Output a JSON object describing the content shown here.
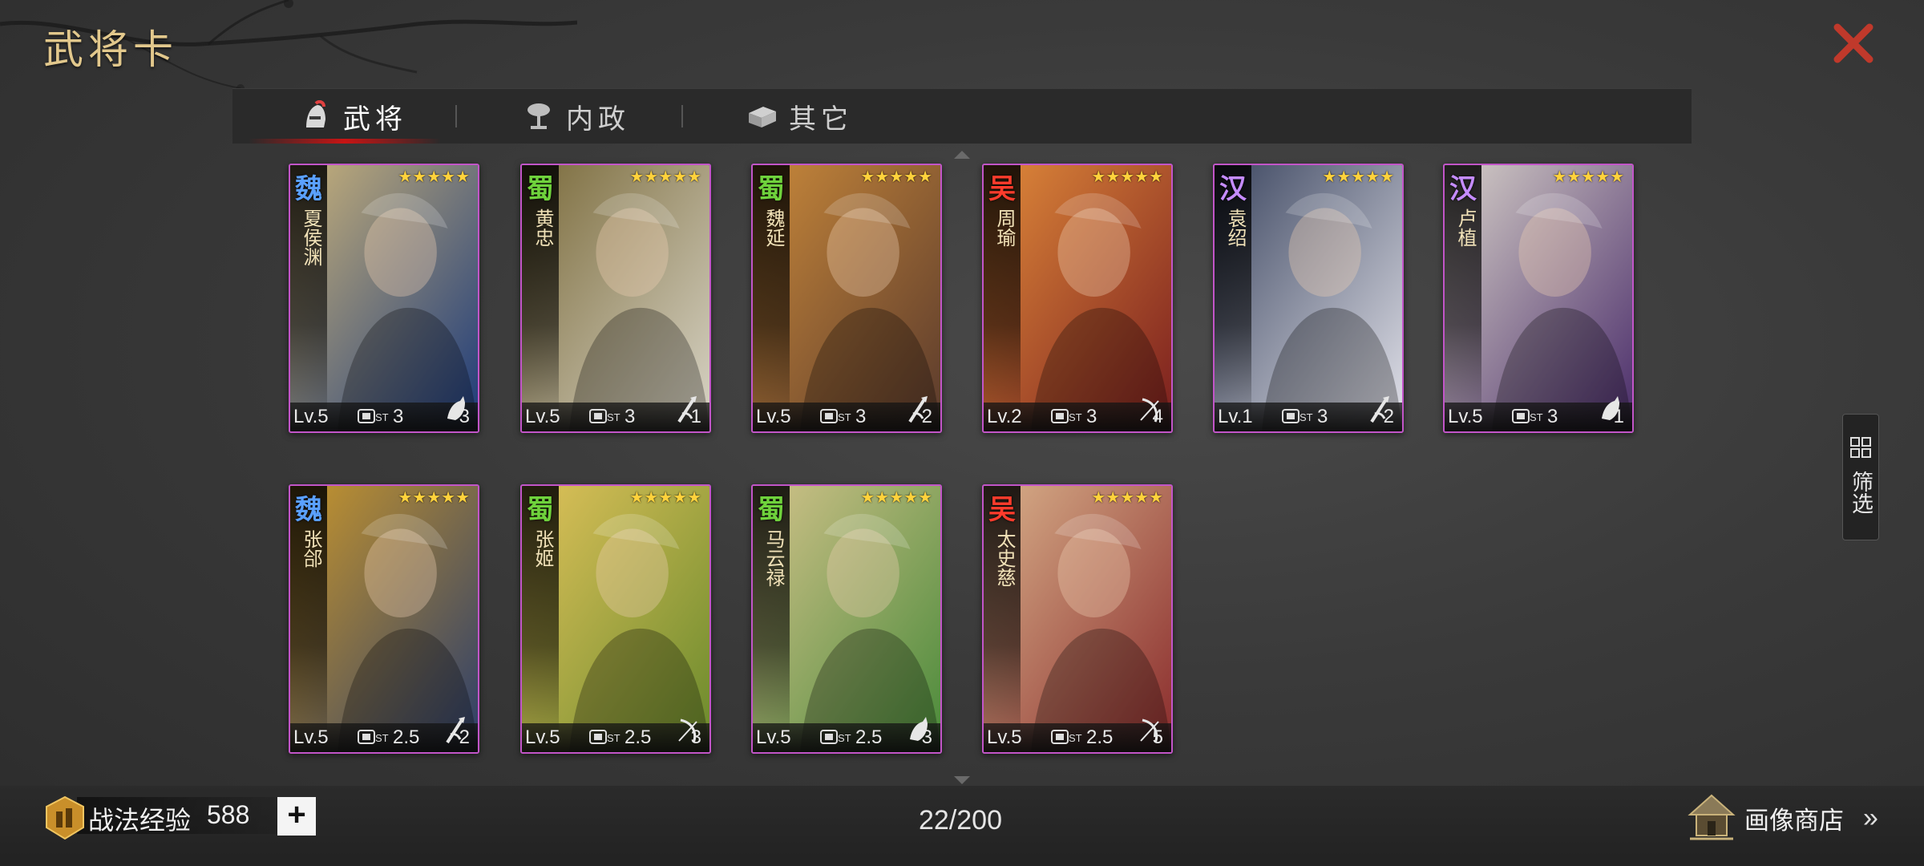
{
  "header": {
    "title": "武将卡"
  },
  "tabs": [
    {
      "label": "武将",
      "icon": "helmet-icon",
      "active": true
    },
    {
      "label": "内政",
      "icon": "tree-icon",
      "active": false
    },
    {
      "label": "其它",
      "icon": "box-icon",
      "active": false
    }
  ],
  "cards": [
    {
      "faction": "魏",
      "faction_color": "#5aa0ff",
      "name": "夏侯渊",
      "stars": "★★★★★",
      "level": "Lv.5",
      "cost": "3",
      "type_icon": "cavalry-icon",
      "count": "3",
      "palette": [
        "#1c3a7a",
        "#c9b27a"
      ]
    },
    {
      "faction": "蜀",
      "faction_color": "#6fd23c",
      "name": "黄忠",
      "stars": "★★★★★",
      "level": "Lv.5",
      "cost": "3",
      "type_icon": "spear-icon",
      "count": "1",
      "palette": [
        "#d8d4c6",
        "#7a6a3a"
      ]
    },
    {
      "faction": "蜀",
      "faction_color": "#6fd23c",
      "name": "魏延",
      "stars": "★★★★★",
      "level": "Lv.5",
      "cost": "3",
      "type_icon": "spear-icon",
      "count": "2",
      "palette": [
        "#5a3a2c",
        "#c8883a"
      ]
    },
    {
      "faction": "吴",
      "faction_color": "#ff3c2c",
      "name": "周瑜",
      "stars": "★★★★★",
      "level": "Lv.2",
      "cost": "3",
      "type_icon": "bow-icon",
      "count": "4",
      "palette": [
        "#7a1e1e",
        "#e08a3a"
      ]
    },
    {
      "faction": "汉",
      "faction_color": "#c58cff",
      "name": "袁绍",
      "stars": "★★★★★",
      "level": "Lv.1",
      "cost": "3",
      "type_icon": "spear-icon",
      "count": "2",
      "palette": [
        "#e2e2ea",
        "#3c4660"
      ]
    },
    {
      "faction": "汉",
      "faction_color": "#c58cff",
      "name": "卢植",
      "stars": "★★★★★",
      "level": "Lv.5",
      "cost": "3",
      "type_icon": "cavalry-icon",
      "count": "1",
      "palette": [
        "#4a2c6a",
        "#d6d0c8"
      ]
    },
    {
      "faction": "魏",
      "faction_color": "#5aa0ff",
      "name": "张郃",
      "stars": "★★★★★",
      "level": "Lv.5",
      "cost": "2.5",
      "type_icon": "spear-icon",
      "count": "2",
      "palette": [
        "#2c3e6a",
        "#c8962c"
      ]
    },
    {
      "faction": "蜀",
      "faction_color": "#6fd23c",
      "name": "张姬",
      "stars": "★★★★★",
      "level": "Lv.5",
      "cost": "2.5",
      "type_icon": "bow-icon",
      "count": "3",
      "palette": [
        "#6a8a2c",
        "#e0c25a"
      ]
    },
    {
      "faction": "蜀",
      "faction_color": "#6fd23c",
      "name": "马云禄",
      "stars": "★★★★★",
      "level": "Lv.5",
      "cost": "2.5",
      "type_icon": "cavalry-icon",
      "count": "3",
      "palette": [
        "#4a8a3a",
        "#d2c28a"
      ]
    },
    {
      "faction": "吴",
      "faction_color": "#ff3c2c",
      "name": "太史慈",
      "stars": "★★★★★",
      "level": "Lv.5",
      "cost": "2.5",
      "type_icon": "bow-icon",
      "count": "5",
      "palette": [
        "#8a2c2c",
        "#d8b08a"
      ]
    }
  ],
  "cost_icon_label": "ST",
  "filter": {
    "label": "筛选"
  },
  "footer": {
    "exp_label": "战法经验",
    "exp_value": "588",
    "add_label": "+",
    "count": "22/200",
    "shop_label": "画像商店",
    "shop_chevron": "»"
  }
}
